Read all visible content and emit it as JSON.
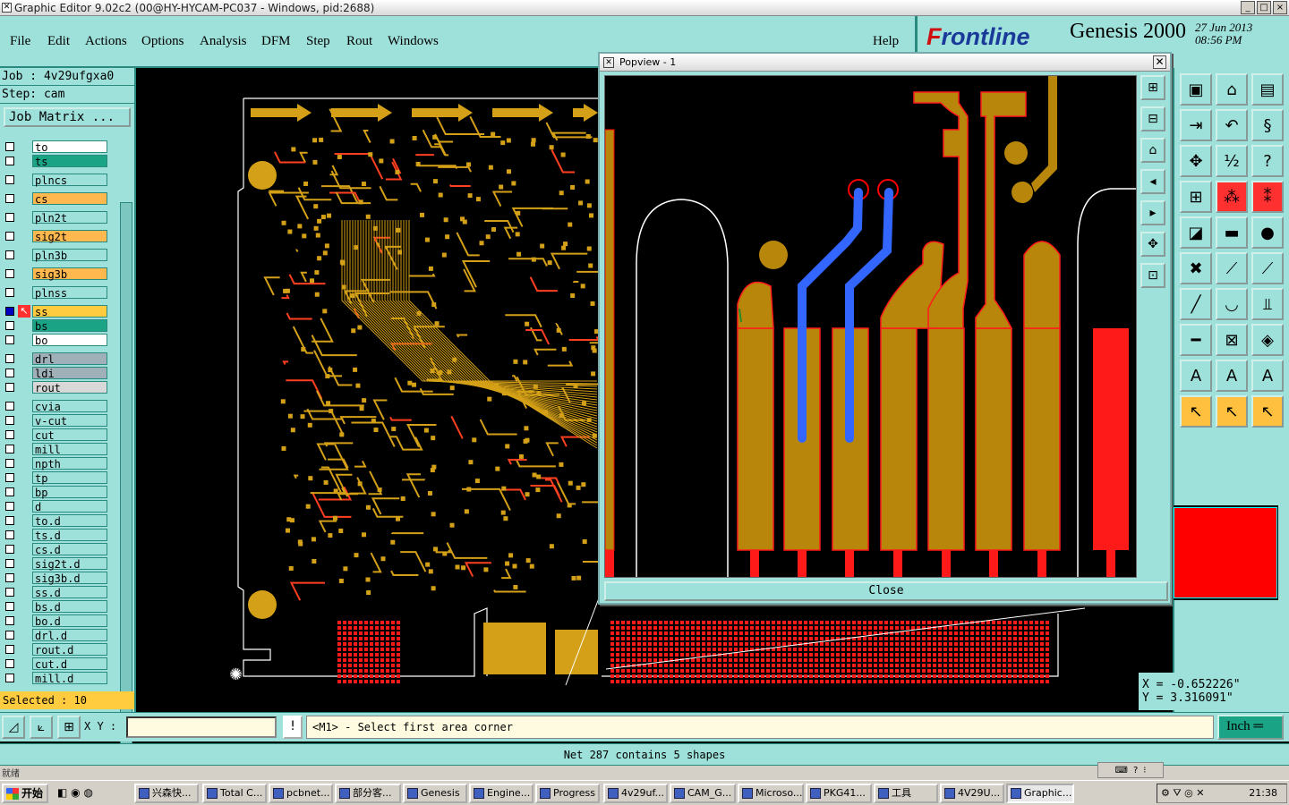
{
  "window": {
    "title": "Graphic Editor 9.02c2 (00@HY-HYCAM-PC037 - Windows, pid:2688)",
    "buttons": [
      "_",
      "□",
      "×"
    ]
  },
  "menu": [
    "File",
    "Edit",
    "Actions",
    "Options",
    "Analysis",
    "DFM",
    "Step",
    "Rout",
    "Windows"
  ],
  "help": "Help",
  "brand": {
    "logo_prefix": "F",
    "logo_rest": "rontline",
    "product": "Genesis 2000",
    "date": "27 Jun 2013",
    "time": "08:56 PM"
  },
  "job": {
    "job_label": "Job : 4v29ufgxa0",
    "step_label": "Step: cam",
    "matrix_button": "Job Matrix ..."
  },
  "layers": [
    {
      "name": "to",
      "color": "white",
      "checked": false
    },
    {
      "name": "ts",
      "color": "green",
      "checked": false
    },
    {
      "name": "plncs",
      "color": "cyan",
      "checked": false
    },
    {
      "name": "cs",
      "color": "orange",
      "checked": false
    },
    {
      "name": "pln2t",
      "color": "cyan",
      "checked": false
    },
    {
      "name": "sig2t",
      "color": "orange",
      "checked": false
    },
    {
      "name": "pln3b",
      "color": "cyan",
      "checked": false
    },
    {
      "name": "sig3b",
      "color": "orange",
      "checked": false
    },
    {
      "name": "plnss",
      "color": "cyan",
      "checked": false
    },
    {
      "name": "ss",
      "color": "gold",
      "checked": true
    },
    {
      "name": "bs",
      "color": "green",
      "checked": false
    },
    {
      "name": "bo",
      "color": "white",
      "checked": false
    },
    {
      "name": "drl",
      "color": "gray",
      "checked": false
    },
    {
      "name": "ldi",
      "color": "gray",
      "checked": false
    },
    {
      "name": "rout",
      "color": "lgray",
      "checked": false
    },
    {
      "name": "cvia",
      "color": "cyan",
      "checked": false
    },
    {
      "name": "v-cut",
      "color": "cyan",
      "checked": false
    },
    {
      "name": "cut",
      "color": "cyan",
      "checked": false
    },
    {
      "name": "mill",
      "color": "cyan",
      "checked": false
    },
    {
      "name": "npth",
      "color": "cyan",
      "checked": false
    },
    {
      "name": "tp",
      "color": "cyan",
      "checked": false
    },
    {
      "name": "bp",
      "color": "cyan",
      "checked": false
    },
    {
      "name": "d",
      "color": "cyan",
      "checked": false
    },
    {
      "name": "to.d",
      "color": "cyan",
      "checked": false
    },
    {
      "name": "ts.d",
      "color": "cyan",
      "checked": false
    },
    {
      "name": "cs.d",
      "color": "cyan",
      "checked": false
    },
    {
      "name": "sig2t.d",
      "color": "cyan",
      "checked": false
    },
    {
      "name": "sig3b.d",
      "color": "cyan",
      "checked": false
    },
    {
      "name": "ss.d",
      "color": "cyan",
      "checked": false
    },
    {
      "name": "bs.d",
      "color": "cyan",
      "checked": false
    },
    {
      "name": "bo.d",
      "color": "cyan",
      "checked": false
    },
    {
      "name": "drl.d",
      "color": "cyan",
      "checked": false
    },
    {
      "name": "rout.d",
      "color": "cyan",
      "checked": false
    },
    {
      "name": "cut.d",
      "color": "cyan",
      "checked": false
    },
    {
      "name": "mill.d",
      "color": "cyan",
      "checked": false
    }
  ],
  "selected": "Selected : 10",
  "popview": {
    "title": "Popview - 1",
    "close": "Close"
  },
  "coords": {
    "x": "X = -0.652226\"",
    "y": "Y = 3.316091\""
  },
  "command": {
    "xy_label": "X Y :",
    "xy_value": "",
    "prompt": "<M1> - Select first area corner",
    "unit": "Inch"
  },
  "status": "Net 287 contains 5 shapes",
  "status_small": "就绪",
  "taskbar": {
    "start": "开始",
    "items": [
      "兴森快...",
      "Total C...",
      "pcbnet...",
      "部分客...",
      "Genesis",
      "Engine...",
      "Progress",
      "4v29uf...",
      "CAM_G...",
      "Microso...",
      "PKG41...",
      "工具",
      "4V29U...",
      "Graphic..."
    ],
    "active": "Graphic...",
    "clock": "21:38"
  },
  "colors": {
    "panel": "#9ee0da",
    "copper": "#b8860b",
    "trace_red": "#ff1a1a",
    "selected_trace": "#3366ff"
  }
}
